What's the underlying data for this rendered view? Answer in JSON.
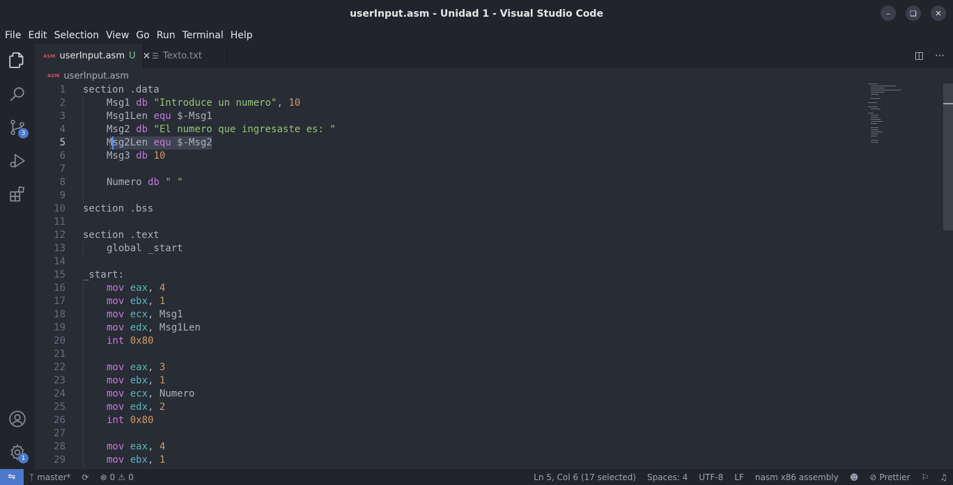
{
  "window": {
    "title": "userInput.asm - Unidad 1 - Visual Studio Code"
  },
  "menu": [
    "File",
    "Edit",
    "Selection",
    "View",
    "Go",
    "Run",
    "Terminal",
    "Help"
  ],
  "activity": {
    "scm_badge": "3",
    "settings_badge": "1"
  },
  "tabs": [
    {
      "icon_text": "ASM",
      "label": "userInput.asm",
      "modified": "U"
    },
    {
      "label": "Texto.txt"
    }
  ],
  "breadcrumb": {
    "icon_text": "ASM",
    "file": "userInput.asm"
  },
  "editor": {
    "lines": [
      {
        "n": "1",
        "indent": 0,
        "tokens": [
          [
            "t",
            "section .data"
          ]
        ]
      },
      {
        "n": "2",
        "indent": 1,
        "tokens": [
          [
            "t",
            "Msg1 "
          ],
          [
            "k",
            "db"
          ],
          [
            "t",
            " "
          ],
          [
            "s",
            "\"Introduce un numero\""
          ],
          [
            "t",
            ", "
          ],
          [
            "n",
            "10"
          ]
        ]
      },
      {
        "n": "3",
        "indent": 1,
        "tokens": [
          [
            "t",
            "Msg1Len "
          ],
          [
            "k",
            "equ"
          ],
          [
            "t",
            " $-Msg1"
          ]
        ]
      },
      {
        "n": "4",
        "indent": 1,
        "tokens": [
          [
            "t",
            "Msg2 "
          ],
          [
            "k",
            "db"
          ],
          [
            "t",
            " "
          ],
          [
            "s",
            "\"El numero que ingresaste es: \""
          ]
        ]
      },
      {
        "n": "5",
        "indent": 1,
        "tokens": [
          [
            "t",
            "Msg2Len "
          ],
          [
            "k",
            "equ"
          ],
          [
            "t",
            " $-Msg2"
          ]
        ]
      },
      {
        "n": "6",
        "indent": 1,
        "tokens": [
          [
            "t",
            "Msg3 "
          ],
          [
            "k",
            "db"
          ],
          [
            "t",
            " "
          ],
          [
            "n",
            "10"
          ]
        ]
      },
      {
        "n": "7",
        "indent": 0,
        "tokens": []
      },
      {
        "n": "8",
        "indent": 1,
        "tokens": [
          [
            "t",
            "Numero "
          ],
          [
            "k",
            "db"
          ],
          [
            "t",
            " "
          ],
          [
            "s",
            "\" \""
          ]
        ]
      },
      {
        "n": "9",
        "indent": 0,
        "tokens": []
      },
      {
        "n": "10",
        "indent": 0,
        "tokens": [
          [
            "t",
            "section .bss"
          ]
        ]
      },
      {
        "n": "11",
        "indent": 0,
        "tokens": []
      },
      {
        "n": "12",
        "indent": 0,
        "tokens": [
          [
            "t",
            "section .text"
          ]
        ]
      },
      {
        "n": "13",
        "indent": 1,
        "tokens": [
          [
            "t",
            "global _start"
          ]
        ]
      },
      {
        "n": "14",
        "indent": 0,
        "tokens": []
      },
      {
        "n": "15",
        "indent": 0,
        "tokens": [
          [
            "t",
            "_start:"
          ]
        ]
      },
      {
        "n": "16",
        "indent": 1,
        "tokens": [
          [
            "k",
            "mov"
          ],
          [
            "t",
            " "
          ],
          [
            "r",
            "eax"
          ],
          [
            "t",
            ", "
          ],
          [
            "n",
            "4"
          ]
        ]
      },
      {
        "n": "17",
        "indent": 1,
        "tokens": [
          [
            "k",
            "mov"
          ],
          [
            "t",
            " "
          ],
          [
            "r",
            "ebx"
          ],
          [
            "t",
            ", "
          ],
          [
            "n",
            "1"
          ]
        ]
      },
      {
        "n": "18",
        "indent": 1,
        "tokens": [
          [
            "k",
            "mov"
          ],
          [
            "t",
            " "
          ],
          [
            "r",
            "ecx"
          ],
          [
            "t",
            ", Msg1"
          ]
        ]
      },
      {
        "n": "19",
        "indent": 1,
        "tokens": [
          [
            "k",
            "mov"
          ],
          [
            "t",
            " "
          ],
          [
            "r",
            "edx"
          ],
          [
            "t",
            ", Msg1Len"
          ]
        ]
      },
      {
        "n": "20",
        "indent": 1,
        "tokens": [
          [
            "k",
            "int"
          ],
          [
            "t",
            " "
          ],
          [
            "n",
            "0x80"
          ]
        ]
      },
      {
        "n": "21",
        "indent": 0,
        "tokens": []
      },
      {
        "n": "22",
        "indent": 1,
        "tokens": [
          [
            "k",
            "mov"
          ],
          [
            "t",
            " "
          ],
          [
            "r",
            "eax"
          ],
          [
            "t",
            ", "
          ],
          [
            "n",
            "3"
          ]
        ]
      },
      {
        "n": "23",
        "indent": 1,
        "tokens": [
          [
            "k",
            "mov"
          ],
          [
            "t",
            " "
          ],
          [
            "r",
            "ebx"
          ],
          [
            "t",
            ", "
          ],
          [
            "n",
            "1"
          ]
        ]
      },
      {
        "n": "24",
        "indent": 1,
        "tokens": [
          [
            "k",
            "mov"
          ],
          [
            "t",
            " "
          ],
          [
            "r",
            "ecx"
          ],
          [
            "t",
            ", Numero"
          ]
        ]
      },
      {
        "n": "25",
        "indent": 1,
        "tokens": [
          [
            "k",
            "mov"
          ],
          [
            "t",
            " "
          ],
          [
            "r",
            "edx"
          ],
          [
            "t",
            ", "
          ],
          [
            "n",
            "2"
          ]
        ]
      },
      {
        "n": "26",
        "indent": 1,
        "tokens": [
          [
            "k",
            "int"
          ],
          [
            "t",
            " "
          ],
          [
            "n",
            "0x80"
          ]
        ]
      },
      {
        "n": "27",
        "indent": 0,
        "tokens": []
      },
      {
        "n": "28",
        "indent": 1,
        "tokens": [
          [
            "k",
            "mov"
          ],
          [
            "t",
            " "
          ],
          [
            "r",
            "eax"
          ],
          [
            "t",
            ", "
          ],
          [
            "n",
            "4"
          ]
        ]
      },
      {
        "n": "29",
        "indent": 1,
        "tokens": [
          [
            "k",
            "mov"
          ],
          [
            "t",
            " "
          ],
          [
            "r",
            "ebx"
          ],
          [
            "t",
            ", "
          ],
          [
            "n",
            "1"
          ]
        ]
      }
    ],
    "current_line": "5"
  },
  "status": {
    "branch": "master*",
    "errors": "0",
    "warnings": "0",
    "position": "Ln 5, Col 6 (17 selected)",
    "spaces": "Spaces: 4",
    "encoding": "UTF-8",
    "eol": "LF",
    "language": "nasm x86 assembly",
    "prettier": "Prettier"
  },
  "colors": {
    "keyword": "#c678dd",
    "string": "#98c379",
    "number": "#d19a66",
    "register": "#56b6c2",
    "text": "#abb2bf",
    "accent": "#4d78cc"
  },
  "icons": [
    "explorer-icon",
    "search-icon",
    "source-control-icon",
    "run-debug-icon",
    "extensions-icon",
    "account-icon",
    "settings-gear-icon",
    "split-editor-icon",
    "more-actions-icon",
    "branch-icon",
    "sync-icon",
    "error-icon",
    "warning-icon",
    "copilot-icon",
    "prettier-icon",
    "feedback-icon",
    "notifications-bell-icon",
    "remote-icon"
  ]
}
